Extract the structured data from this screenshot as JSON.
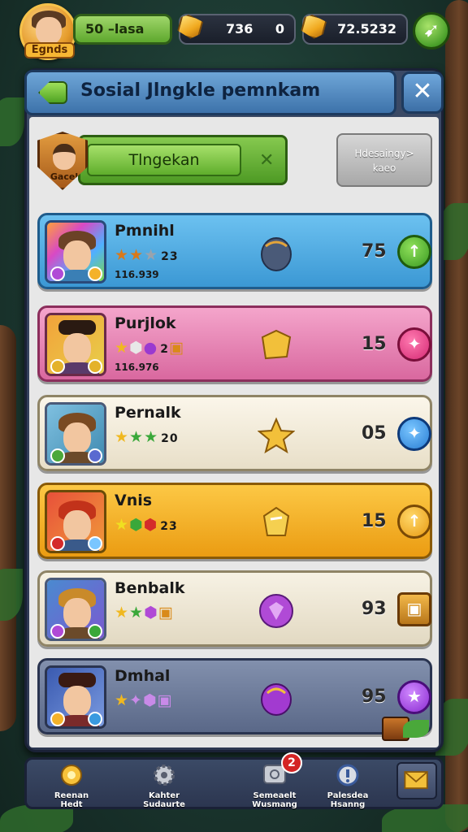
{
  "topbar": {
    "avatar_badge": "Egnds",
    "level": "50 –lasa",
    "resource1": "736",
    "resource2": "0",
    "resource3": "72.5232"
  },
  "header": {
    "title": "Sosial Jlngkle pemnkam"
  },
  "summary": {
    "shield_label": "Gacel",
    "name": "Tlngekan",
    "status_line1": "Hdesaingy>",
    "status_line2": "kaeo"
  },
  "rows": [
    {
      "name": "Pmnihl",
      "rank": "23",
      "score": "116.939",
      "value": "75",
      "color": "#5fb3e6",
      "btn_glyph": "↑"
    },
    {
      "name": "Purjlok",
      "rank": "2",
      "score": "116.976",
      "value": "15",
      "color": "#e98aba",
      "btn_glyph": "✦"
    },
    {
      "name": "Pernalk",
      "rank": "20",
      "score": "",
      "value": "05",
      "color": "#f3ecd8",
      "btn_glyph": "✦"
    },
    {
      "name": "Vnis",
      "rank": "23",
      "score": "",
      "value": "15",
      "color": "#f6b22c",
      "btn_glyph": "↑"
    },
    {
      "name": "Benbalk",
      "rank": "",
      "score": "",
      "value": "93",
      "color": "#efe9d8",
      "btn_glyph": "▣"
    },
    {
      "name": "Dmhal",
      "rank": "",
      "score": "",
      "value": "95",
      "color": "#6e7c9a",
      "btn_glyph": "★"
    }
  ],
  "nav": [
    {
      "label1": "Reenan",
      "label2": "Hedt"
    },
    {
      "label1": "Kahter",
      "label2": "Sudaurte"
    },
    {
      "label1": "Semeaelt",
      "label2": "Wusmang"
    },
    {
      "label1": "Palesdea",
      "label2": "Hsanng"
    }
  ],
  "notification_count": "2",
  "colors": {
    "row_blue": "#5fb3e6",
    "row_pink": "#e98aba",
    "row_cream": "#f3ecd8",
    "row_gold": "#f6b22c",
    "row_slate": "#6e7c9a",
    "accent_green": "#5ea82d"
  }
}
